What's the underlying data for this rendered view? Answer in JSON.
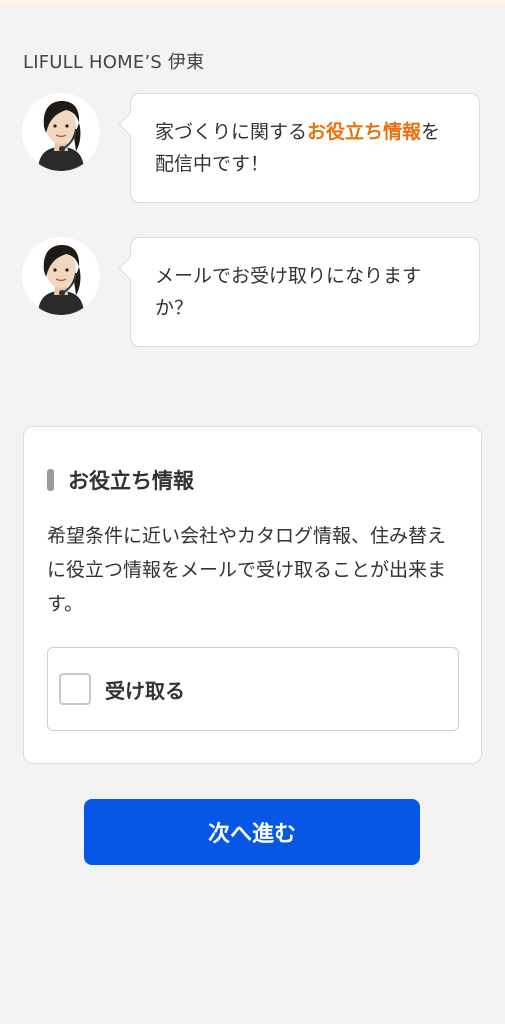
{
  "header": {
    "title": "LIFULL HOME’S 伊東"
  },
  "chat": {
    "message1": {
      "prefix": "家づくりに関する",
      "highlight": "お役立ち情報",
      "suffix": "を配信中です！"
    },
    "message2": {
      "text": "メールでお受け取りになりますか？"
    }
  },
  "info_card": {
    "title": "お役立ち情報",
    "description": "希望条件に近い会社やカタログ情報、住み替えに役立つ情報をメールで受け取ることが出来ます。",
    "checkbox_label": "受け取る",
    "checkbox_checked": false
  },
  "next_button": {
    "label": "次へ進む"
  },
  "colors": {
    "accent": "#e8730e",
    "primary_button": "#0656e8",
    "background": "#f3f3f3"
  },
  "icons": {
    "avatar": "operator-avatar-icon"
  }
}
